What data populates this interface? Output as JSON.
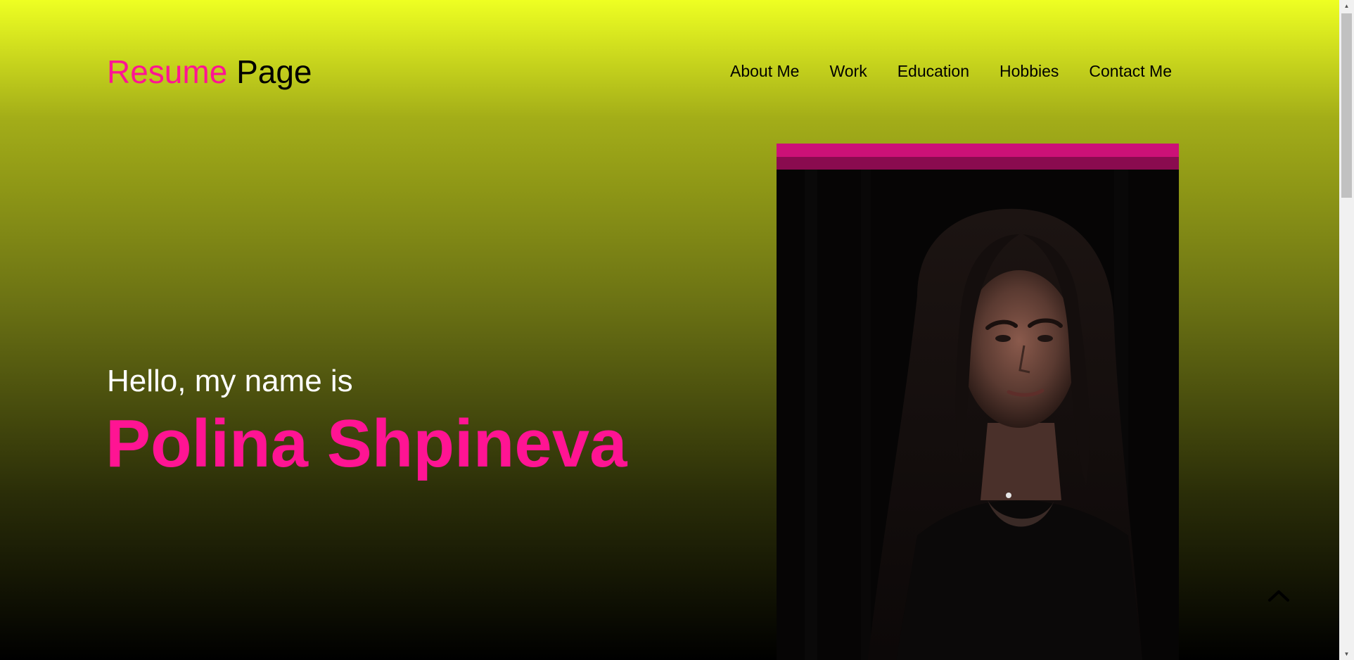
{
  "header": {
    "logo_accent": "Resume",
    "logo_plain": "Page",
    "nav": [
      {
        "label": "About Me"
      },
      {
        "label": "Work"
      },
      {
        "label": "Education"
      },
      {
        "label": "Hobbies"
      },
      {
        "label": "Contact Me"
      }
    ]
  },
  "hero": {
    "greeting": "Hello, my name is",
    "name": "Polina Shpineva"
  },
  "icons": {
    "scroll_top": "chevron-up-icon",
    "scrollbar_up": "triangle-up-icon",
    "scrollbar_down": "triangle-down-icon"
  },
  "colors": {
    "accent": "#ff1493",
    "gradient_top": "#eeff22",
    "gradient_bottom": "#000000",
    "frame_bar_1": "#cc1177",
    "frame_bar_2": "#8a0b4f"
  }
}
